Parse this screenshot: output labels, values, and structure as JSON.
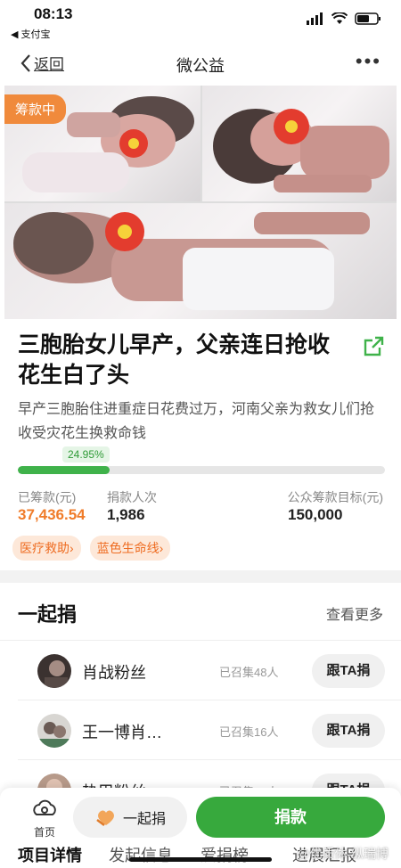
{
  "status_bar": {
    "time": "08:13",
    "back_app": "◀ 支付宝"
  },
  "nav": {
    "back_label": "返回",
    "title": "微公益",
    "more": "•••"
  },
  "hero": {
    "badge": "筹款中"
  },
  "project": {
    "title": "三胞胎女儿早产，父亲连日抢收花生白了头",
    "subtitle": "早产三胞胎住进重症日花费过万，河南父亲为救女儿们抢收受灾花生换救命钱"
  },
  "progress": {
    "percent_label": "24.95%",
    "fraction": 0.2495
  },
  "stats": {
    "raised_label": "已筹款(元)",
    "raised_value": "37,436.54",
    "donors_label": "捐款人次",
    "donors_value": "1,986",
    "goal_label": "公众筹款目标(元)",
    "goal_value": "150,000"
  },
  "tags": [
    "医疗救助›",
    "蓝色生命线›"
  ],
  "together": {
    "title": "一起捐",
    "more": "查看更多",
    "rows": [
      {
        "name": "肖战粉丝",
        "count": "已召集48人",
        "button": "跟TA捐"
      },
      {
        "name": "王一博肖…",
        "count": "已召集16人",
        "button": "跟TA捐"
      },
      {
        "name": "热巴粉丝",
        "count": "已召集13人",
        "button": "跟TA捐"
      }
    ]
  },
  "bottom_bar": {
    "home_label": "首页",
    "together_label": "一起捐",
    "donate_label": "捐款"
  },
  "tabs": [
    "项目详情",
    "发起信息",
    "爱捐榜",
    "进展汇报"
  ],
  "watermark": "@优质体-纵瑞博",
  "colors": {
    "accent_green": "#37a93d",
    "accent_orange": "#f07c2a",
    "badge_orange": "#f08a3c"
  }
}
